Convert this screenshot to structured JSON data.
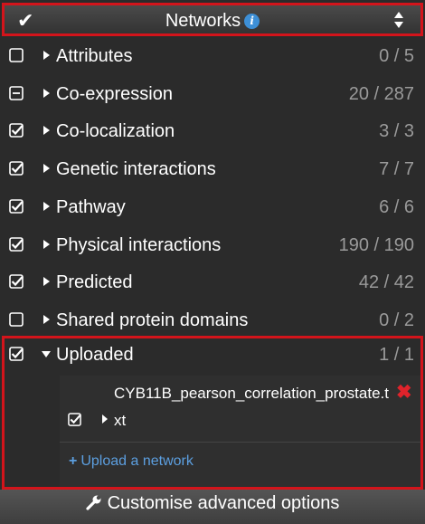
{
  "header": {
    "title": "Networks",
    "info_icon": "info-icon",
    "check_icon": "checkmark-icon",
    "sort_icon": "sort-updown-icon"
  },
  "networks": [
    {
      "label": "Attributes",
      "count": "0 / 5",
      "state": "unchecked"
    },
    {
      "label": "Co-expression",
      "count": "20 / 287",
      "state": "indeterminate"
    },
    {
      "label": "Co-localization",
      "count": "3 / 3",
      "state": "checked"
    },
    {
      "label": "Genetic interactions",
      "count": "7 / 7",
      "state": "checked"
    },
    {
      "label": "Pathway",
      "count": "6 / 6",
      "state": "checked"
    },
    {
      "label": "Physical interactions",
      "count": "190 / 190",
      "state": "checked"
    },
    {
      "label": "Predicted",
      "count": "42 / 42",
      "state": "checked"
    },
    {
      "label": "Shared protein domains",
      "count": "0 / 2",
      "state": "unchecked"
    }
  ],
  "uploaded": {
    "label": "Uploaded",
    "count": "1 / 1",
    "state": "checked",
    "file_name": "CYB11B_pearson_correlation_prostate.t",
    "sub_item": {
      "label": "xt",
      "state": "checked"
    },
    "upload_link": "Upload a network"
  },
  "footer": {
    "label": "Customise advanced options"
  },
  "colors": {
    "highlight_border": "#d3141b",
    "link": "#5c9fe0",
    "delete": "#e0232b",
    "count_text": "#9a9a9a",
    "background": "#2b2b2b"
  }
}
